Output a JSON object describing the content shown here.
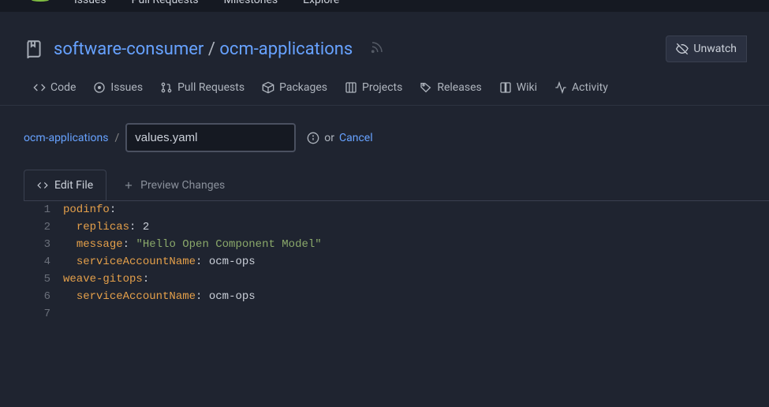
{
  "topnav": {
    "issues": "Issues",
    "pulls": "Pull Requests",
    "milestones": "Milestones",
    "explore": "Explore"
  },
  "repo": {
    "owner": "software-consumer",
    "sep": "/",
    "name": "ocm-applications",
    "unwatch": "Unwatch"
  },
  "tabs": {
    "code": "Code",
    "issues": "Issues",
    "pulls": "Pull Requests",
    "packages": "Packages",
    "projects": "Projects",
    "releases": "Releases",
    "wiki": "Wiki",
    "activity": "Activity"
  },
  "breadcrumb": {
    "root": "ocm-applications",
    "sep": "/",
    "filename": "values.yaml",
    "or": "or",
    "cancel": "Cancel"
  },
  "editorTabs": {
    "edit": "Edit File",
    "preview": "Preview Changes"
  },
  "code": {
    "lines": [
      {
        "n": "1",
        "tokens": [
          {
            "cls": "tok-key",
            "t": "podinfo"
          },
          {
            "cls": "tok-punct",
            "t": ":"
          }
        ]
      },
      {
        "n": "2",
        "tokens": [
          {
            "cls": "tok-punct",
            "t": "  "
          },
          {
            "cls": "tok-key",
            "t": "replicas"
          },
          {
            "cls": "tok-punct",
            "t": ": "
          },
          {
            "cls": "tok-num",
            "t": "2"
          }
        ]
      },
      {
        "n": "3",
        "tokens": [
          {
            "cls": "tok-punct",
            "t": "  "
          },
          {
            "cls": "tok-key",
            "t": "message"
          },
          {
            "cls": "tok-punct",
            "t": ": "
          },
          {
            "cls": "tok-str",
            "t": "\"Hello Open Component Model\""
          }
        ]
      },
      {
        "n": "4",
        "tokens": [
          {
            "cls": "tok-punct",
            "t": "  "
          },
          {
            "cls": "tok-key",
            "t": "serviceAccountName"
          },
          {
            "cls": "tok-punct",
            "t": ": "
          },
          {
            "cls": "tok-val",
            "t": "ocm-ops"
          }
        ]
      },
      {
        "n": "5",
        "tokens": [
          {
            "cls": "tok-key",
            "t": "weave-gitops"
          },
          {
            "cls": "tok-punct",
            "t": ":"
          }
        ]
      },
      {
        "n": "6",
        "tokens": [
          {
            "cls": "tok-punct",
            "t": "  "
          },
          {
            "cls": "tok-key",
            "t": "serviceAccountName"
          },
          {
            "cls": "tok-punct",
            "t": ": "
          },
          {
            "cls": "tok-val",
            "t": "ocm-ops"
          }
        ]
      },
      {
        "n": "7",
        "tokens": []
      }
    ]
  }
}
